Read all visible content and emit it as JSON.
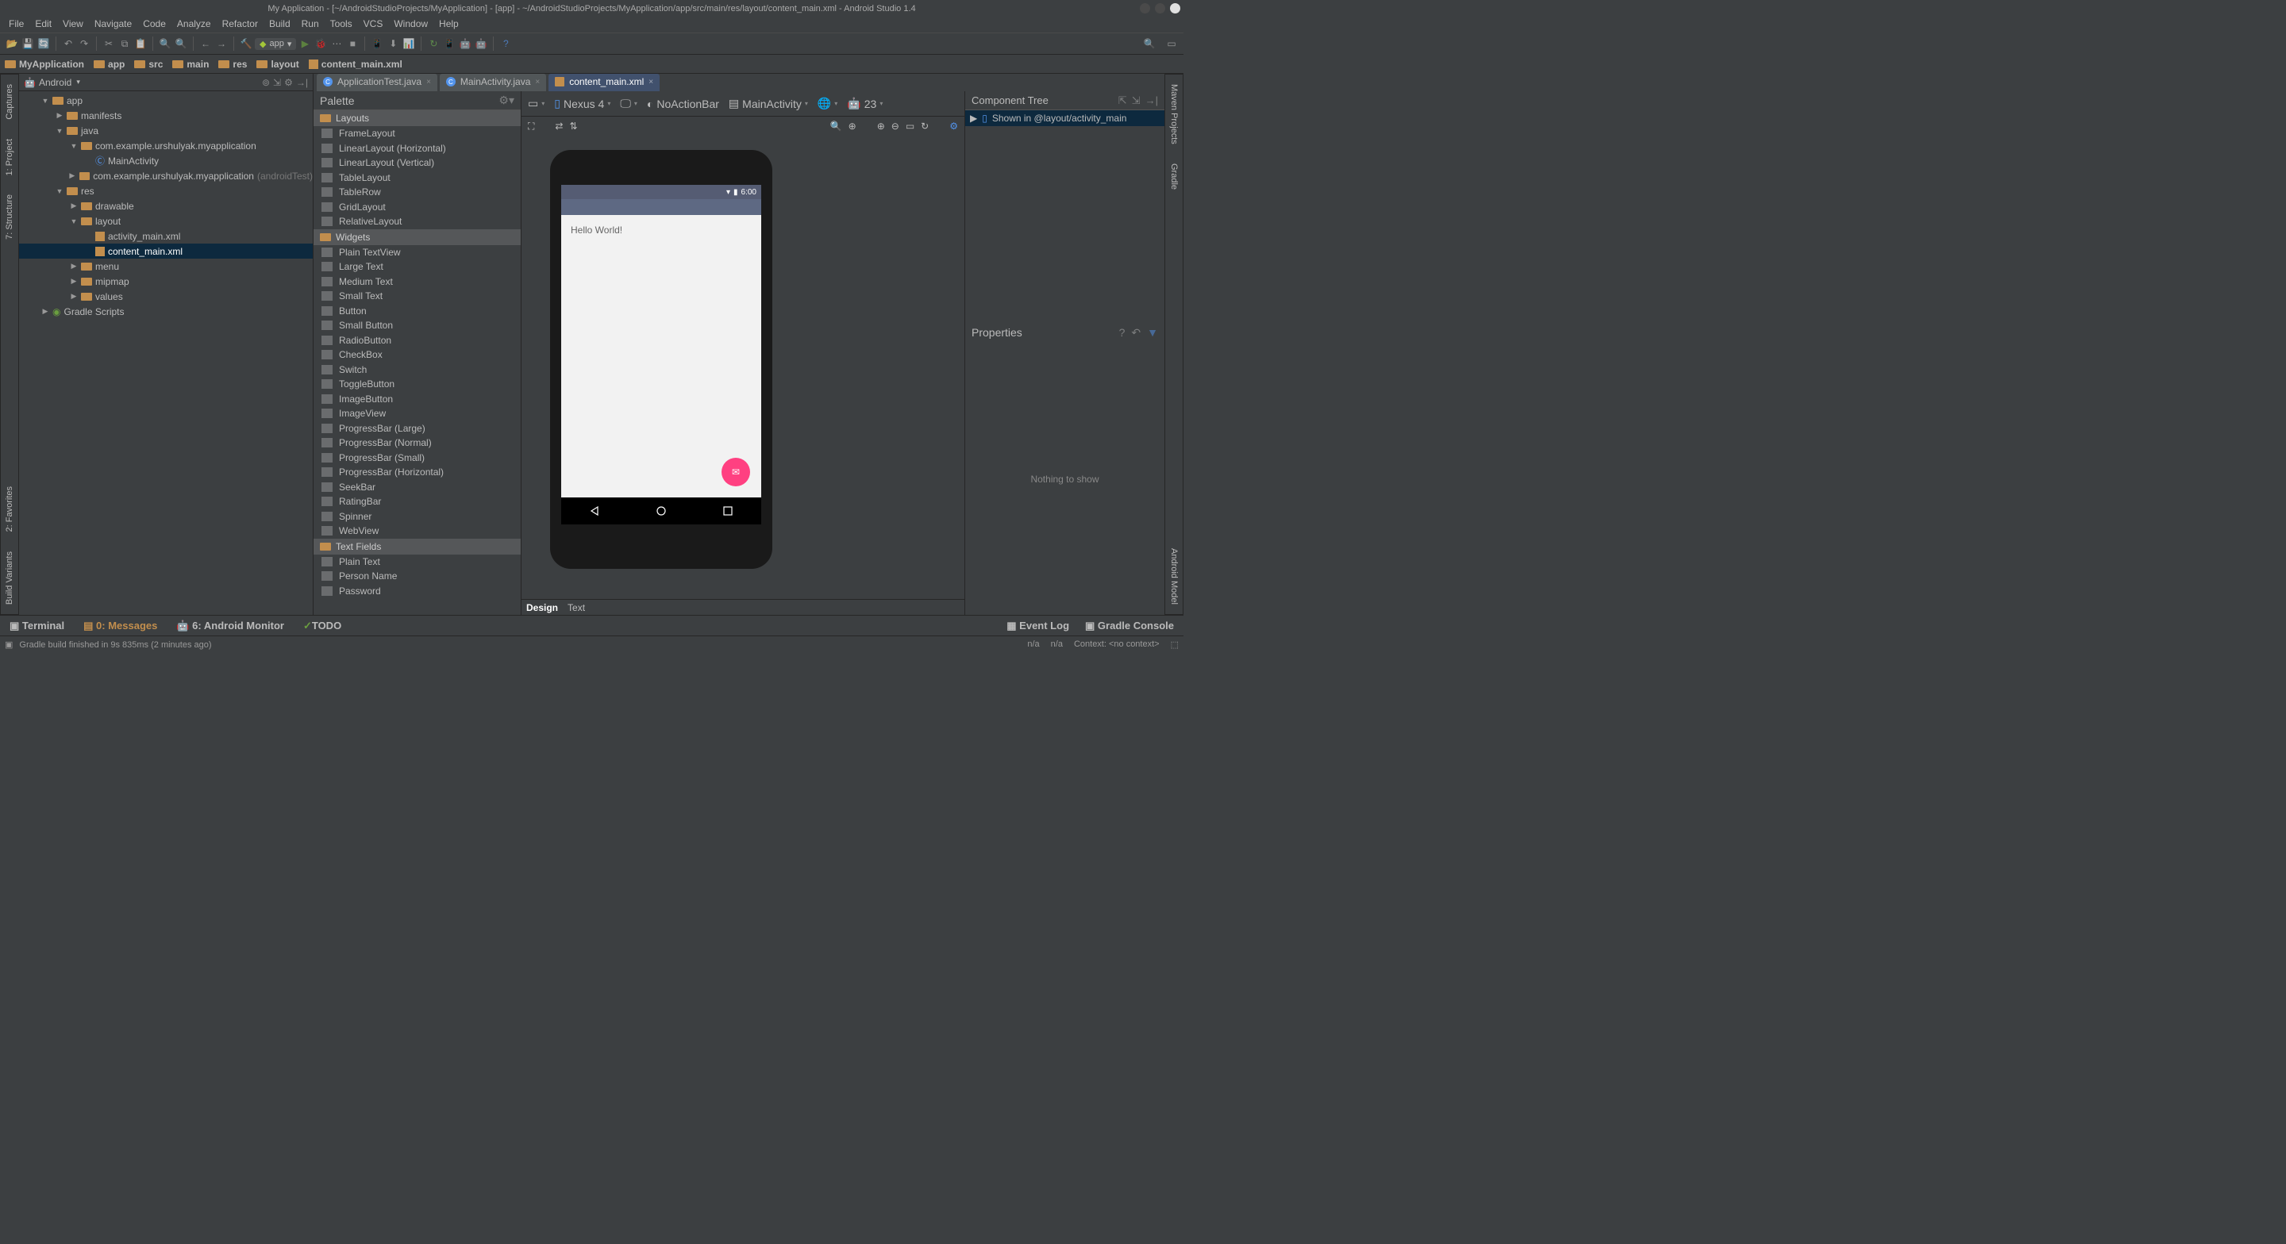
{
  "window": {
    "title": "My Application - [~/AndroidStudioProjects/MyApplication] - [app] - ~/AndroidStudioProjects/MyApplication/app/src/main/res/layout/content_main.xml - Android Studio 1.4"
  },
  "menu": [
    "File",
    "Edit",
    "View",
    "Navigate",
    "Code",
    "Analyze",
    "Refactor",
    "Build",
    "Run",
    "Tools",
    "VCS",
    "Window",
    "Help"
  ],
  "run_config": "app",
  "breadcrumbs": [
    "MyApplication",
    "app",
    "src",
    "main",
    "res",
    "layout",
    "content_main.xml"
  ],
  "left_gutter": [
    "Captures",
    "1: Project",
    "7: Structure",
    "2: Favorites",
    "Build Variants"
  ],
  "right_gutter": [
    "Maven Projects",
    "Gradle",
    "Android Model"
  ],
  "project_panel": {
    "mode": "Android",
    "tree": [
      {
        "indent": 0,
        "arrow": "▼",
        "icon": "folder",
        "label": "app"
      },
      {
        "indent": 1,
        "arrow": "▶",
        "icon": "folder",
        "label": "manifests"
      },
      {
        "indent": 1,
        "arrow": "▼",
        "icon": "folder",
        "label": "java"
      },
      {
        "indent": 2,
        "arrow": "▼",
        "icon": "package",
        "label": "com.example.urshulyak.myapplication"
      },
      {
        "indent": 3,
        "arrow": "",
        "icon": "class",
        "label": "MainActivity"
      },
      {
        "indent": 2,
        "arrow": "▶",
        "icon": "package",
        "label": "com.example.urshulyak.myapplication",
        "suffix": "(androidTest)"
      },
      {
        "indent": 1,
        "arrow": "▼",
        "icon": "folder",
        "label": "res"
      },
      {
        "indent": 2,
        "arrow": "▶",
        "icon": "folder",
        "label": "drawable"
      },
      {
        "indent": 2,
        "arrow": "▼",
        "icon": "folder",
        "label": "layout"
      },
      {
        "indent": 3,
        "arrow": "",
        "icon": "xml",
        "label": "activity_main.xml"
      },
      {
        "indent": 3,
        "arrow": "",
        "icon": "xml",
        "label": "content_main.xml",
        "selected": true
      },
      {
        "indent": 2,
        "arrow": "▶",
        "icon": "folder",
        "label": "menu"
      },
      {
        "indent": 2,
        "arrow": "▶",
        "icon": "folder",
        "label": "mipmap"
      },
      {
        "indent": 2,
        "arrow": "▶",
        "icon": "folder",
        "label": "values"
      },
      {
        "indent": 0,
        "arrow": "▶",
        "icon": "gradle",
        "label": "Gradle Scripts"
      }
    ]
  },
  "tabs": [
    {
      "label": "ApplicationTest.java",
      "icon": "class",
      "active": false
    },
    {
      "label": "MainActivity.java",
      "icon": "class",
      "active": false
    },
    {
      "label": "content_main.xml",
      "icon": "xml",
      "active": true
    }
  ],
  "palette": {
    "title": "Palette",
    "groups": [
      {
        "name": "Layouts",
        "items": [
          "FrameLayout",
          "LinearLayout (Horizontal)",
          "LinearLayout (Vertical)",
          "TableLayout",
          "TableRow",
          "GridLayout",
          "RelativeLayout"
        ]
      },
      {
        "name": "Widgets",
        "items": [
          "Plain TextView",
          "Large Text",
          "Medium Text",
          "Small Text",
          "Button",
          "Small Button",
          "RadioButton",
          "CheckBox",
          "Switch",
          "ToggleButton",
          "ImageButton",
          "ImageView",
          "ProgressBar (Large)",
          "ProgressBar (Normal)",
          "ProgressBar (Small)",
          "ProgressBar (Horizontal)",
          "SeekBar",
          "RatingBar",
          "Spinner",
          "WebView"
        ]
      },
      {
        "name": "Text Fields",
        "items": [
          "Plain Text",
          "Person Name",
          "Password"
        ]
      }
    ]
  },
  "design_toolbar": {
    "device": "Nexus 4",
    "theme": "NoActionBar",
    "activity": "MainActivity",
    "api": "23"
  },
  "preview": {
    "status_time": "6:00",
    "body_text": "Hello World!"
  },
  "component_tree": {
    "title": "Component Tree",
    "item": "Shown in @layout/activity_main"
  },
  "properties": {
    "title": "Properties",
    "empty": "Nothing to show"
  },
  "design_tabs": {
    "design": "Design",
    "text": "Text"
  },
  "bottom": {
    "terminal": "Terminal",
    "messages": "0: Messages",
    "monitor": "6: Android Monitor",
    "todo": "TODO",
    "eventlog": "Event Log",
    "gradleconsole": "Gradle Console"
  },
  "status": {
    "msg": "Gradle build finished in 9s 835ms (2 minutes ago)",
    "na1": "n/a",
    "na2": "n/a",
    "context": "Context: <no context>"
  }
}
